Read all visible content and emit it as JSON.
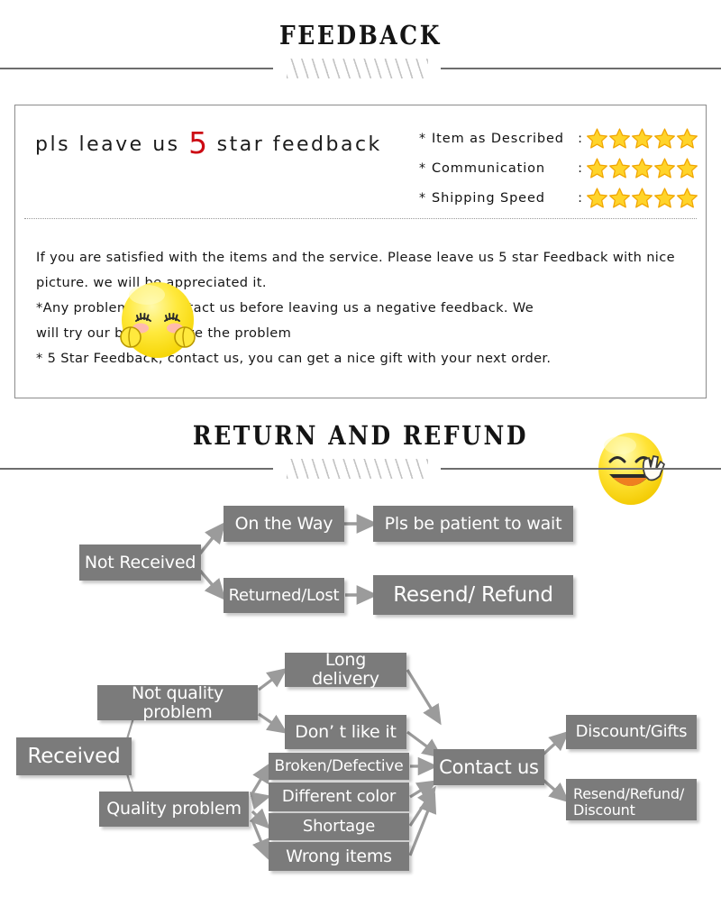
{
  "sections": {
    "feedback_heading": "FEEDBACK",
    "return_heading": "RETURN AND REFUND"
  },
  "feedback": {
    "headline_before": "pls leave us",
    "headline_number": "5",
    "headline_after": "star feedback",
    "bullet_mark": "*",
    "ratings": [
      {
        "label": "Item as Described",
        "colon": ":",
        "stars": 5
      },
      {
        "label": "Communication",
        "colon": ":",
        "stars": 5
      },
      {
        "label": "Shipping Speed",
        "colon": ":",
        "stars": 5
      }
    ],
    "paragraphs": [
      "If you are satisfied with the items and the service. Please leave us 5 star Feedback with nice",
      "picture. we will be appreciated it.",
      "*Any problem, pls contact us before leaving us a negative feedback. We",
      "will try our best to solve  the problem",
      "* 5 Star Feedback, contact us, you can get a nice gift with your next order."
    ],
    "emoji_shy": "shy-face-emoji",
    "emoji_peace": "smiling-face-peace-sign-emoji"
  },
  "flow_not_received": {
    "root": "Not Received",
    "branches": [
      {
        "cause": "On the Way",
        "outcome": "Pls be patient to wait"
      },
      {
        "cause": "Returned/Lost",
        "outcome": "Resend/ Refund"
      }
    ]
  },
  "flow_received": {
    "root": "Received",
    "groups": [
      {
        "label": "Not quality problem",
        "items": [
          "Long delivery",
          "Don’  t like it"
        ]
      },
      {
        "label": "Quality problem",
        "items": [
          "Broken/Defective",
          "Different color",
          "Shortage",
          "Wrong items"
        ]
      }
    ],
    "hub": "Contact us",
    "outcomes": [
      "Discount/Gifts",
      "Resend/Refund/\nDiscount"
    ],
    "outcome_resend_line1": "Resend/Refund/",
    "outcome_resend_line2": "Discount"
  },
  "colors": {
    "node_fill": "#7b7b7b",
    "node_text": "#ffffff",
    "star_fill": "#ffd42a",
    "star_stroke": "#f0a500",
    "accent_red": "#cc0a13",
    "rule": "#6d6d6d",
    "panel_border": "#8c8c8c"
  }
}
